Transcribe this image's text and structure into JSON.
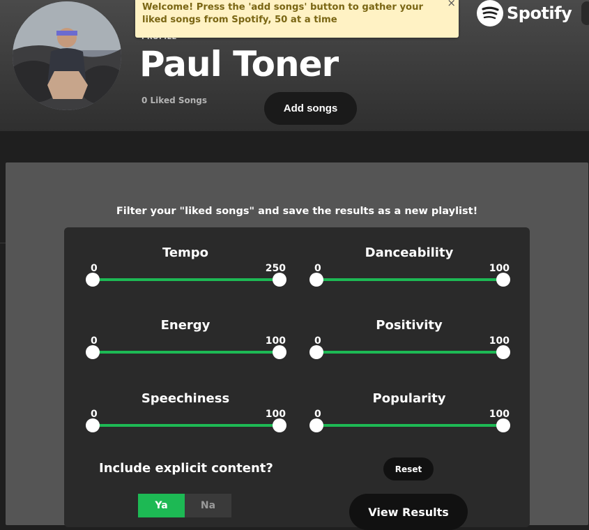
{
  "toast": {
    "message": "Welcome! Press the 'add songs' button to gather your liked songs from Spotify, 50 at a time",
    "close": "×"
  },
  "brand": {
    "name": "Spotify",
    "icon": "spotify-logo-icon"
  },
  "profile": {
    "label": "PROFILE",
    "name": "Paul Toner",
    "liked": "0 Liked Songs"
  },
  "actions": {
    "add_songs": "Add songs"
  },
  "filter": {
    "title": "Filter your \"liked songs\" and save the results as a new playlist!",
    "sliders": [
      {
        "label": "Tempo",
        "min": "0",
        "max": "250",
        "low": 0,
        "high": 250
      },
      {
        "label": "Danceability",
        "min": "0",
        "max": "100",
        "low": 0,
        "high": 100
      },
      {
        "label": "Energy",
        "min": "0",
        "max": "100",
        "low": 0,
        "high": 100
      },
      {
        "label": "Positivity",
        "min": "0",
        "max": "100",
        "low": 0,
        "high": 100
      },
      {
        "label": "Speechiness",
        "min": "0",
        "max": "100",
        "low": 0,
        "high": 100
      },
      {
        "label": "Popularity",
        "min": "0",
        "max": "100",
        "low": 0,
        "high": 100
      }
    ],
    "explicit": {
      "label": "Include explicit content?",
      "yes": "Ya",
      "no": "Na",
      "selected": "Ya"
    },
    "reset": "Reset",
    "view_results": "View Results"
  },
  "colors": {
    "accent": "#1db954",
    "toast_bg": "#fff2c4",
    "toast_text": "#7a6614"
  }
}
